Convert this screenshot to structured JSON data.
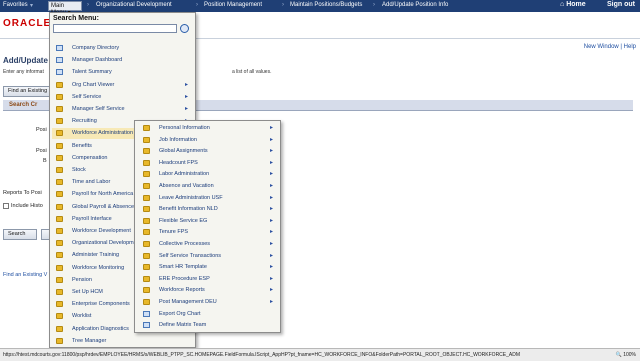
{
  "topbar": {
    "favorites": "Favorites",
    "main_menu": "Main Menu",
    "breadcrumbs": [
      "Organizational Development",
      "Position Management",
      "Maintain Positions/Budgets",
      "Add/Update Position Info"
    ],
    "home": "Home",
    "sign_out": "Sign out"
  },
  "header": {
    "logo": "ORACLE",
    "new_window": "New Window",
    "help": "Help"
  },
  "page": {
    "title": "Add/Update P",
    "instructions": "Enter any informat",
    "instructions_right": "a list of all values.",
    "find_existing": "Find an Existing",
    "search_criteria": "Search Cr",
    "posi_label": "Posi",
    "posi2_label": "Posi",
    "bu_label": "B",
    "reports_to": "Reports To Posi",
    "include_history": "Include Histo",
    "search_button": "Search",
    "find_existing_link": "Find an Existing V"
  },
  "menu": {
    "title": "Search Menu:",
    "items": [
      {
        "label": "Company Directory",
        "icon": "document-icon",
        "submenu": false
      },
      {
        "label": "Manager Dashboard",
        "icon": "document-icon",
        "submenu": false
      },
      {
        "label": "Talent Summary",
        "icon": "document-icon",
        "submenu": false
      },
      {
        "label": "Org Chart Viewer",
        "icon": "folder-icon",
        "submenu": true
      },
      {
        "label": "Self Service",
        "icon": "folder-icon",
        "submenu": true
      },
      {
        "label": "Manager Self Service",
        "icon": "folder-icon",
        "submenu": true
      },
      {
        "label": "Recruiting",
        "icon": "folder-icon",
        "submenu": true
      },
      {
        "label": "Workforce Administration",
        "icon": "folder-icon",
        "submenu": true,
        "highlighted": true
      },
      {
        "label": "Benefits",
        "icon": "folder-icon",
        "submenu": false
      },
      {
        "label": "Compensation",
        "icon": "folder-icon",
        "submenu": false
      },
      {
        "label": "Stock",
        "icon": "folder-icon",
        "submenu": false
      },
      {
        "label": "Time and Labor",
        "icon": "folder-icon",
        "submenu": false
      },
      {
        "label": "Payroll for North America",
        "icon": "folder-icon",
        "submenu": false
      },
      {
        "label": "Global Payroll & Absence",
        "icon": "folder-icon",
        "submenu": false
      },
      {
        "label": "Payroll Interface",
        "icon": "folder-icon",
        "submenu": false
      },
      {
        "label": "Workforce Development",
        "icon": "folder-icon",
        "submenu": false
      },
      {
        "label": "Organizational Development",
        "icon": "folder-icon",
        "submenu": false
      },
      {
        "label": "Administer Training",
        "icon": "folder-icon",
        "submenu": false
      },
      {
        "label": "Workforce Monitoring",
        "icon": "folder-icon",
        "submenu": false
      },
      {
        "label": "Pension",
        "icon": "folder-icon",
        "submenu": false
      },
      {
        "label": "Set Up HCM",
        "icon": "folder-icon",
        "submenu": false
      },
      {
        "label": "Enterprise Components",
        "icon": "folder-icon",
        "submenu": false
      },
      {
        "label": "Worklist",
        "icon": "folder-icon",
        "submenu": false
      },
      {
        "label": "Application Diagnostics",
        "icon": "folder-icon",
        "submenu": false
      },
      {
        "label": "Tree Manager",
        "icon": "folder-icon",
        "submenu": false
      }
    ]
  },
  "submenu": {
    "items": [
      {
        "label": "Personal Information",
        "icon": "folder-icon",
        "submenu": true
      },
      {
        "label": "Job Information",
        "icon": "folder-icon",
        "submenu": true
      },
      {
        "label": "Global Assignments",
        "icon": "folder-icon",
        "submenu": true
      },
      {
        "label": "Headcount FPS",
        "icon": "folder-icon",
        "submenu": true
      },
      {
        "label": "Labor Administration",
        "icon": "folder-icon",
        "submenu": true
      },
      {
        "label": "Absence and Vacation",
        "icon": "folder-icon",
        "submenu": true
      },
      {
        "label": "Leave Administration USF",
        "icon": "folder-icon",
        "submenu": true
      },
      {
        "label": "Benefit Information NLD",
        "icon": "folder-icon",
        "submenu": true
      },
      {
        "label": "Flexible Service EG",
        "icon": "folder-icon",
        "submenu": true
      },
      {
        "label": "Tenure FPS",
        "icon": "folder-icon",
        "submenu": true
      },
      {
        "label": "Collective Processes",
        "icon": "folder-icon",
        "submenu": true
      },
      {
        "label": "Self Service Transactions",
        "icon": "folder-icon",
        "submenu": true
      },
      {
        "label": "Smart HR Template",
        "icon": "folder-icon",
        "submenu": true
      },
      {
        "label": "ERE Procedure ESP",
        "icon": "folder-icon",
        "submenu": true
      },
      {
        "label": "Workforce Reports",
        "icon": "folder-icon",
        "submenu": true
      },
      {
        "label": "Post Management DEU",
        "icon": "folder-icon",
        "submenu": true
      },
      {
        "label": "Export Org Chart",
        "icon": "document-icon",
        "submenu": false
      },
      {
        "label": "Define Matrix Team",
        "icon": "document-icon",
        "submenu": false
      }
    ]
  },
  "statusbar": {
    "url": "https://htest.mdcourts.gov:11800/psp/hrdev/EMPLOYEE/HRMS/s/WEBLIB_PTPP_SC.HOMEPAGE.FieldFormula.IScript_AppHP?pt_fname=HC_WORKFORCE_INFO&FolderPath=PORTAL_ROOT_OBJECT.HC_WORKFORCE_ADM",
    "zoom": "100%"
  },
  "colors": {
    "topbar": "#1f3f75",
    "menu_bg": "#f5f5f0",
    "highlight": "#f7e9b6",
    "folder": "#e8b82a",
    "logo": "#cc0000"
  }
}
